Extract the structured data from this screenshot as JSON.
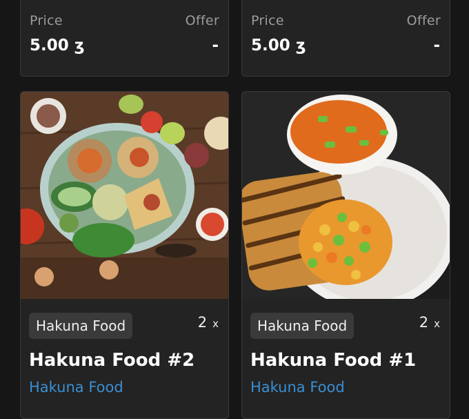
{
  "currency": "ʒ",
  "products": [
    {
      "price_label": "Price",
      "price_value": "5.00",
      "offer_label": "Offer",
      "offer_value": "-",
      "brand": "Hakuna Food",
      "quantity": "2",
      "quantity_suffix": "x",
      "title": "Hakuna Food #2",
      "vendor": "Hakuna Food",
      "image": "tacos-platter-photo"
    },
    {
      "price_label": "Price",
      "price_value": "5.00",
      "offer_label": "Offer",
      "offer_value": "-",
      "brand": "Hakuna Food",
      "quantity": "2",
      "quantity_suffix": "x",
      "title": "Hakuna Food #1",
      "vendor": "Hakuna Food",
      "image": "grilled-fish-soup-photo"
    }
  ],
  "colors": {
    "background": "#161616",
    "card": "#232323",
    "chip": "#3a3a3a",
    "label": "#9c9c9c",
    "vendor_link": "#3a8fd4"
  }
}
